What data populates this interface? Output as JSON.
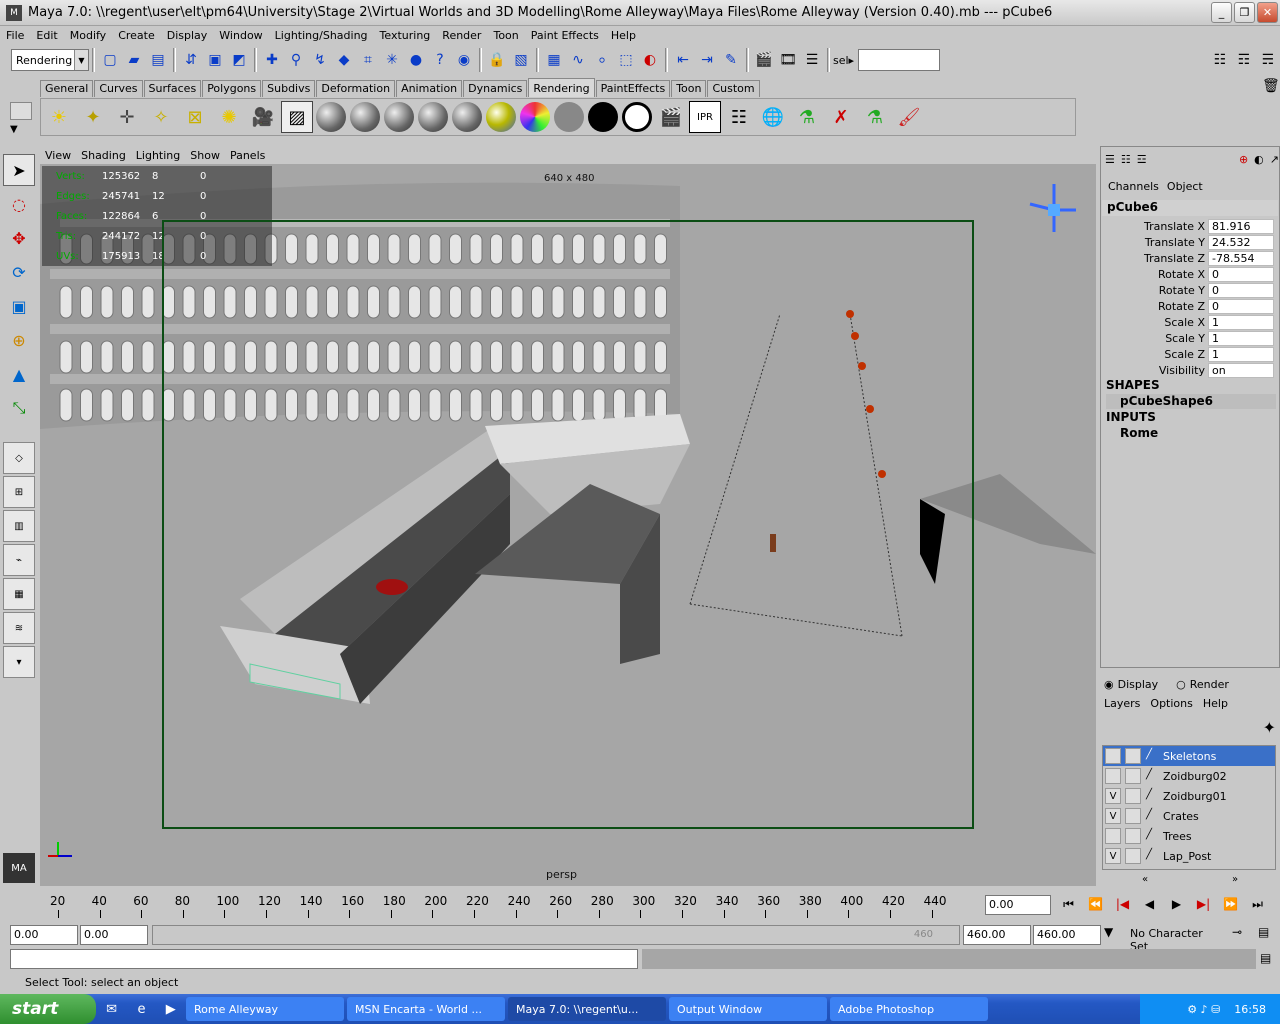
{
  "window": {
    "title": "Maya 7.0: \\\\regent\\user\\elt\\pm64\\University\\Stage 2\\Virtual Worlds and 3D Modelling\\Rome Alleyway\\Maya Files\\Rome Alleyway (Version 0.40).mb  ---  pCube6"
  },
  "menubar": [
    "File",
    "Edit",
    "Modify",
    "Create",
    "Display",
    "Window",
    "Lighting/Shading",
    "Texturing",
    "Render",
    "Toon",
    "Paint Effects",
    "Help"
  ],
  "toolbar": {
    "mode": "Rendering",
    "sel_label": "sel▸"
  },
  "shelf_tabs": [
    "General",
    "Curves",
    "Surfaces",
    "Polygons",
    "Subdivs",
    "Deformation",
    "Animation",
    "Dynamics",
    "Rendering",
    "PaintEffects",
    "Toon",
    "Custom"
  ],
  "shelf_active": "Rendering",
  "panel_menu": [
    "View",
    "Shading",
    "Lighting",
    "Show",
    "Panels"
  ],
  "hud": {
    "rows": [
      {
        "label": "Verts:",
        "a": "125362",
        "b": "8",
        "c": "0"
      },
      {
        "label": "Edges:",
        "a": "245741",
        "b": "12",
        "c": "0"
      },
      {
        "label": "Faces:",
        "a": "122864",
        "b": "6",
        "c": "0"
      },
      {
        "label": "Tris:",
        "a": "244172",
        "b": "12",
        "c": "0"
      },
      {
        "label": "UVs:",
        "a": "175913",
        "b": "18",
        "c": "0"
      }
    ],
    "resolution": "640 x 480",
    "camera": "persp"
  },
  "channels": {
    "menu": [
      "Channels",
      "Object"
    ],
    "object": "pCube6",
    "attrs": [
      {
        "name": "Translate X",
        "value": "81.916"
      },
      {
        "name": "Translate Y",
        "value": "24.532"
      },
      {
        "name": "Translate Z",
        "value": "-78.554"
      },
      {
        "name": "Rotate X",
        "value": "0"
      },
      {
        "name": "Rotate Y",
        "value": "0"
      },
      {
        "name": "Rotate Z",
        "value": "0"
      },
      {
        "name": "Scale X",
        "value": "1"
      },
      {
        "name": "Scale Y",
        "value": "1"
      },
      {
        "name": "Scale Z",
        "value": "1"
      },
      {
        "name": "Visibility",
        "value": "on"
      }
    ],
    "shapes_label": "SHAPES",
    "shape_item": "pCubeShape6",
    "inputs_label": "INPUTS",
    "input_item": "Rome"
  },
  "layers": {
    "display_label": "Display",
    "render_label": "Render",
    "menu": [
      "Layers",
      "Options",
      "Help"
    ],
    "items": [
      {
        "name": "Skeletons",
        "v": ""
      },
      {
        "name": "Zoidburg02",
        "v": ""
      },
      {
        "name": "Zoidburg01",
        "v": "V"
      },
      {
        "name": "Crates",
        "v": "V"
      },
      {
        "name": "Trees",
        "v": ""
      },
      {
        "name": "Lap_Post",
        "v": "V"
      }
    ]
  },
  "timeline": {
    "ticks": [
      "20",
      "40",
      "60",
      "80",
      "100",
      "120",
      "140",
      "160",
      "180",
      "200",
      "220",
      "240",
      "260",
      "280",
      "300",
      "320",
      "340",
      "360",
      "380",
      "400",
      "420",
      "440"
    ],
    "current": "0.00",
    "range_start": "0.00",
    "range_inner": "0.00",
    "range_end_a": "460.00",
    "range_end_b": "460.00",
    "range_label": "460",
    "char_set": "No Character Set"
  },
  "help_line": "Select Tool: select an object",
  "taskbar": {
    "start": "start",
    "tasks": [
      "Rome Alleyway",
      "MSN Encarta - World ...",
      "Maya 7.0: \\\\regent\\u...",
      "Output Window",
      "Adobe Photoshop"
    ],
    "clock": "16:58"
  }
}
